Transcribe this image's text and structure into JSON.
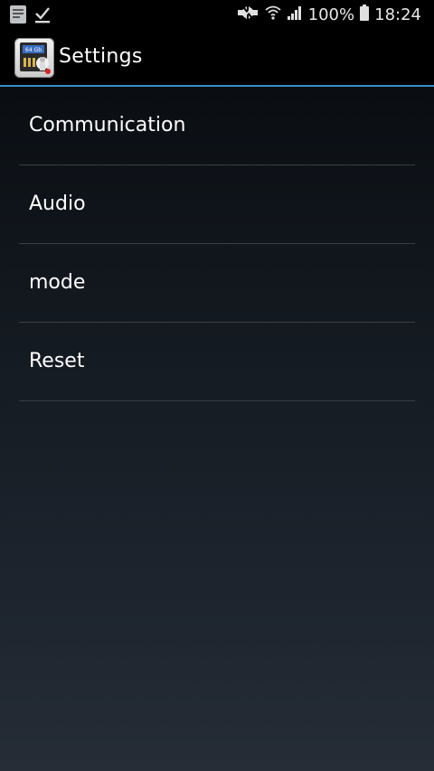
{
  "status_bar": {
    "battery_percent": "100%",
    "time": "18:24",
    "icons": [
      "notes-icon",
      "check-download-icon",
      "mute-icon",
      "wifi-icon",
      "signal-icon",
      "battery-icon"
    ]
  },
  "action_bar": {
    "title": "Settings",
    "app_icon_text": "64 Gb",
    "divider_color": "#3b8ec2"
  },
  "settings_list": {
    "items": [
      {
        "label": "Communication"
      },
      {
        "label": "Audio"
      },
      {
        "label": "mode"
      },
      {
        "label": "Reset"
      }
    ]
  }
}
